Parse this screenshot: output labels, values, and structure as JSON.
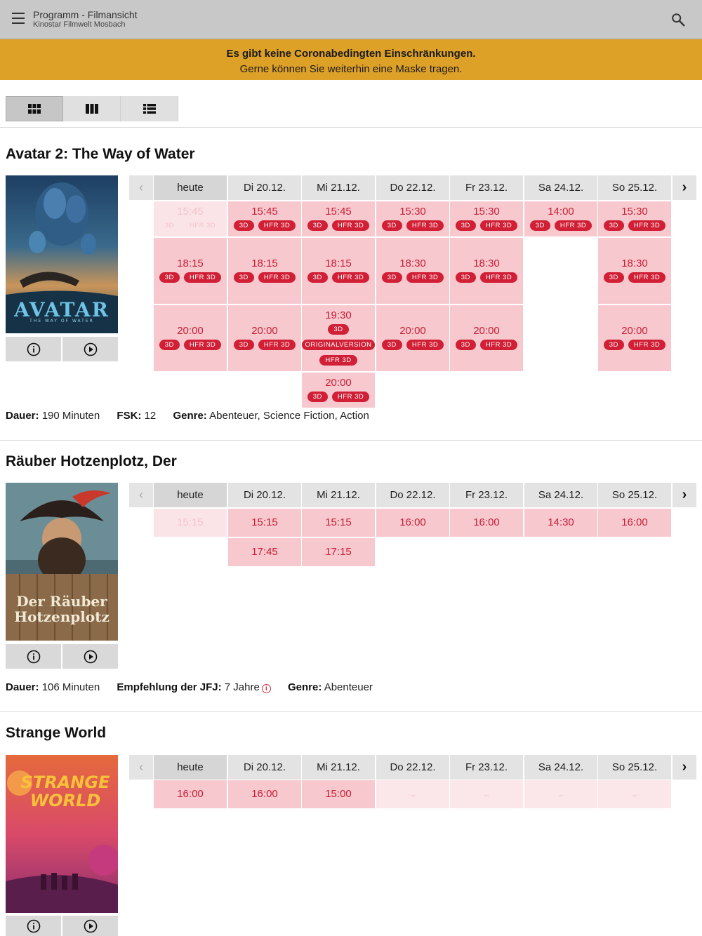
{
  "appbar": {
    "title": "Programm - Filmansicht",
    "subtitle": "Kinostar Filmwelt Mosbach",
    "menu_icon": "menu-icon",
    "search_icon": "search-icon"
  },
  "banner": {
    "line1": "Es gibt keine Coronabedingten Einschränkungen.",
    "line2": "Gerne können Sie weiterhin eine Maske tragen.",
    "color": "#dea128"
  },
  "view_toggle": {
    "options": [
      "grid-view-icon",
      "columns-view-icon",
      "list-view-icon"
    ],
    "active": "grid-view-icon"
  },
  "days": [
    "heute",
    "Di 20.12.",
    "Mi 21.12.",
    "Do 22.12.",
    "Fr 23.12.",
    "Sa 24.12.",
    "So 25.12."
  ],
  "films": [
    {
      "title": "Avatar 2: The Way of Water",
      "poster": {
        "wordmark": "AVATAR",
        "tagline": "THE WAY OF WATER"
      },
      "meta": {
        "duration_label": "Dauer:",
        "duration": "190 Minuten",
        "fsk_label": "FSK:",
        "fsk": "12",
        "genre_label": "Genre:",
        "genre": "Abenteuer, Science Fiction, Action"
      },
      "shows": [
        [
          "15:45"
        ],
        [
          "15:45",
          "18:15",
          "20:00"
        ],
        [
          "15:45",
          "18:15",
          "19:30",
          "20:00"
        ],
        [
          "15:30",
          "18:30",
          "20:00"
        ],
        [
          "15:30",
          "18:30",
          "20:00"
        ],
        [
          "14:00"
        ],
        [
          "15:30",
          "18:30",
          "20:00"
        ]
      ],
      "tags": {
        "3d": "3D",
        "hfr3d": "HFR 3D",
        "ov": "ORIGINALVERSION"
      }
    },
    {
      "title": "Räuber Hotzenplotz, Der",
      "poster": {
        "wordmark": "Der Räuber Hotzenplotz"
      },
      "meta": {
        "duration_label": "Dauer:",
        "duration": "106 Minuten",
        "jfj_label": "Empfehlung der JFJ:",
        "jfj": "7 Jahre",
        "genre_label": "Genre:",
        "genre": "Abenteuer"
      },
      "shows": [
        [
          "15:15"
        ],
        [
          "15:15",
          "17:45"
        ],
        [
          "15:15",
          "17:15"
        ],
        [
          "16:00"
        ],
        [
          "16:00"
        ],
        [
          "14:30"
        ],
        [
          "16:00"
        ]
      ]
    },
    {
      "title": "Strange World",
      "poster": {
        "wordmark": "STRANGE WORLD"
      },
      "shows": [
        [
          "16:00"
        ],
        [
          "16:00"
        ],
        [
          "15:00"
        ],
        [
          "–"
        ],
        [
          "–"
        ],
        [
          "–"
        ],
        [
          "–"
        ]
      ]
    }
  ]
}
